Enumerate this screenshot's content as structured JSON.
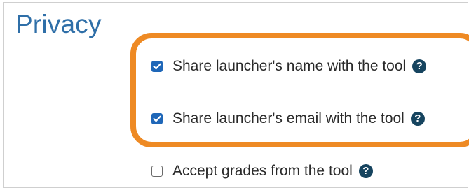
{
  "section": {
    "title": "Privacy"
  },
  "options": [
    {
      "label": "Share launcher's name with the tool",
      "checked": true,
      "help_icon": "question-circle-icon"
    },
    {
      "label": "Share launcher's email with the tool",
      "checked": true,
      "help_icon": "question-circle-icon"
    },
    {
      "label": "Accept grades from the tool",
      "checked": false,
      "help_icon": "question-circle-icon"
    }
  ],
  "help_glyph": "?",
  "colors": {
    "title": "#2f6fa8",
    "checkbox_checked": "#1f67b8",
    "help_icon": "#16445f",
    "highlight_outline": "#ee8a24"
  }
}
